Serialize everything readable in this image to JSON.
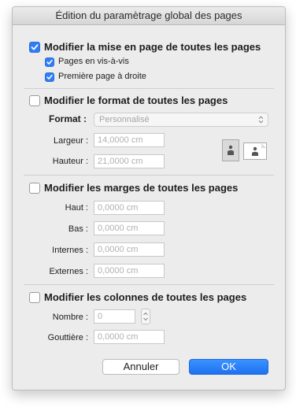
{
  "window": {
    "title": "Édition du paramètrage global des pages"
  },
  "layout_section": {
    "label": "Modifier la mise en page de toutes les pages",
    "checked": true,
    "options": [
      {
        "label": "Pages en vis-à-vis",
        "checked": true
      },
      {
        "label": "Première page à droite",
        "checked": true
      }
    ]
  },
  "format_section": {
    "label": "Modifier le format de toutes les pages",
    "checked": false,
    "format_label": "Format :",
    "format_value": "Personnalisé",
    "width_label": "Largeur :",
    "width_value": "14,0000 cm",
    "height_label": "Hauteur :",
    "height_value": "21,0000 cm",
    "orientation": [
      "portrait-icon",
      "landscape-icon"
    ]
  },
  "margins_section": {
    "label": "Modifier les marges de toutes les pages",
    "checked": false,
    "top_label": "Haut :",
    "top_value": "0,0000 cm",
    "bottom_label": "Bas :",
    "bottom_value": "0,0000 cm",
    "inner_label": "Internes :",
    "inner_value": "0,0000 cm",
    "outer_label": "Externes :",
    "outer_value": "0,0000 cm"
  },
  "columns_section": {
    "label": "Modifier les colonnes de toutes les pages",
    "checked": false,
    "count_label": "Nombre :",
    "count_value": "0",
    "gutter_label": "Gouttière :",
    "gutter_value": "0,0000 cm"
  },
  "buttons": {
    "cancel": "Annuler",
    "ok": "OK"
  },
  "colors": {
    "accent": "#2f7ef5",
    "dialog_bg": "#ececec"
  }
}
